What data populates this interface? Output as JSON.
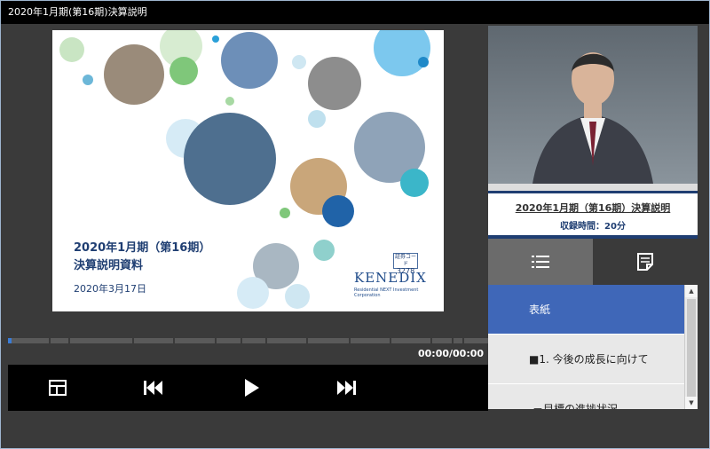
{
  "window": {
    "title": "2020年1月期(第16期)決算説明"
  },
  "slide": {
    "title_line1": "2020年1月期（第16期）",
    "title_line2": "決算説明資料",
    "date": "2020年3月17日",
    "logo_code_label": "証券コード",
    "logo_code": "3278",
    "logo_name": "KENEDIX",
    "logo_sub": "Residential NEXT Investment Corporation"
  },
  "player": {
    "time": "00:00/00:00",
    "progress": 0.0
  },
  "video": {
    "caption_title": "2020年1月期（第16期）決算説明",
    "caption_sub": "収録時間：20分"
  },
  "toc": {
    "items": [
      {
        "label": "表紙",
        "active": true
      },
      {
        "label": "■1. 今後の成長に向けて",
        "active": false
      },
      {
        "label": "－目標の進捗状況",
        "active": false
      }
    ]
  },
  "colors": {
    "accent": "#3f67b8",
    "navy": "#1f3e72"
  }
}
